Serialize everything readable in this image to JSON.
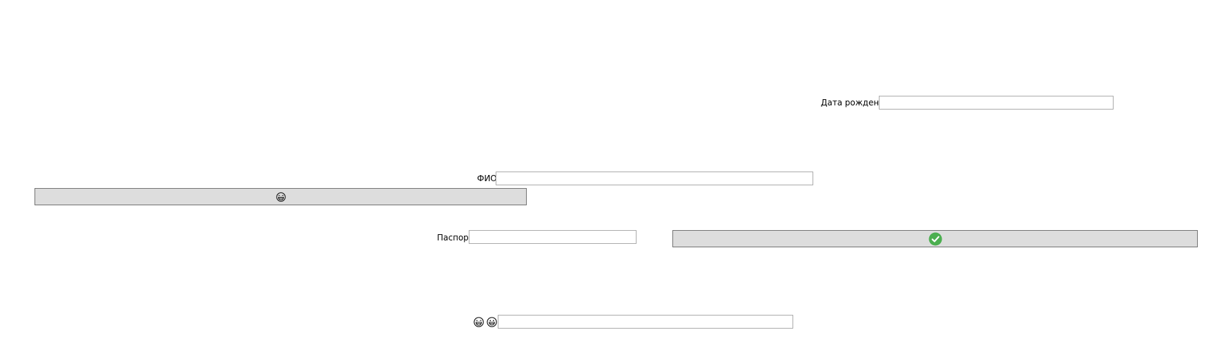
{
  "form": {
    "birth_date": {
      "label": "Дата рождения",
      "value": "",
      "placeholder": ""
    },
    "full_name": {
      "label": "ФИО",
      "value": "",
      "placeholder": ""
    },
    "passport": {
      "label": "Паспорт",
      "value": "",
      "placeholder": ""
    },
    "extra": {
      "value": "",
      "placeholder": ""
    }
  },
  "buttons": {
    "smile_button": {
      "icon": "laughing-face-icon"
    },
    "confirm_button": {
      "icon": "green-check-icon",
      "color": "#4caf50"
    }
  },
  "icons": {
    "extra_icon_1": "laughing-face-icon",
    "extra_icon_2": "grinning-face-icon"
  },
  "colors": {
    "button_background": "#dddddd",
    "field_border": "#a9a9a9",
    "check_green": "#4caf50"
  }
}
